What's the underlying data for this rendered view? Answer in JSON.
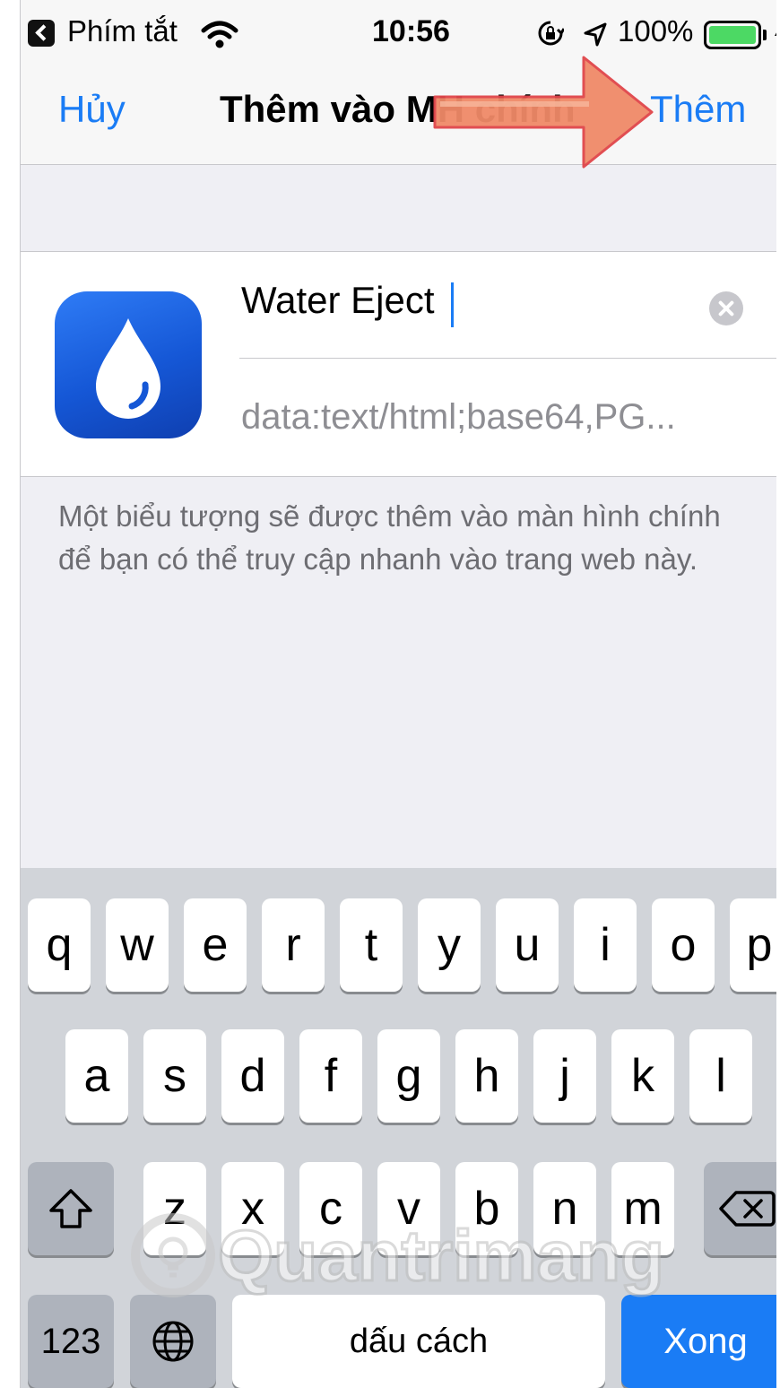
{
  "status_bar": {
    "back_app": "Phím tắt",
    "time": "10:56",
    "battery": "100%"
  },
  "nav": {
    "cancel": "Hủy",
    "title": "Thêm vào MH chính",
    "add": "Thêm"
  },
  "form": {
    "name_value": "Water Eject",
    "url_value": "data:text/html;base64,PG..."
  },
  "description": "Một biểu tượng sẽ được thêm vào màn hình chính để bạn có thể truy cập nhanh vào trang web này.",
  "keyboard": {
    "row1": [
      "q",
      "w",
      "e",
      "r",
      "t",
      "y",
      "u",
      "i",
      "o",
      "p"
    ],
    "row2": [
      "a",
      "s",
      "d",
      "f",
      "g",
      "h",
      "j",
      "k",
      "l"
    ],
    "row3": [
      "z",
      "x",
      "c",
      "v",
      "b",
      "n",
      "m"
    ],
    "numbers": "123",
    "space": "dấu cách",
    "done": "Xong"
  },
  "watermark": "Quantrimang",
  "colors": {
    "accent": "#1a7cf5",
    "arrow": "#f08a68",
    "battery": "#4cd964"
  }
}
